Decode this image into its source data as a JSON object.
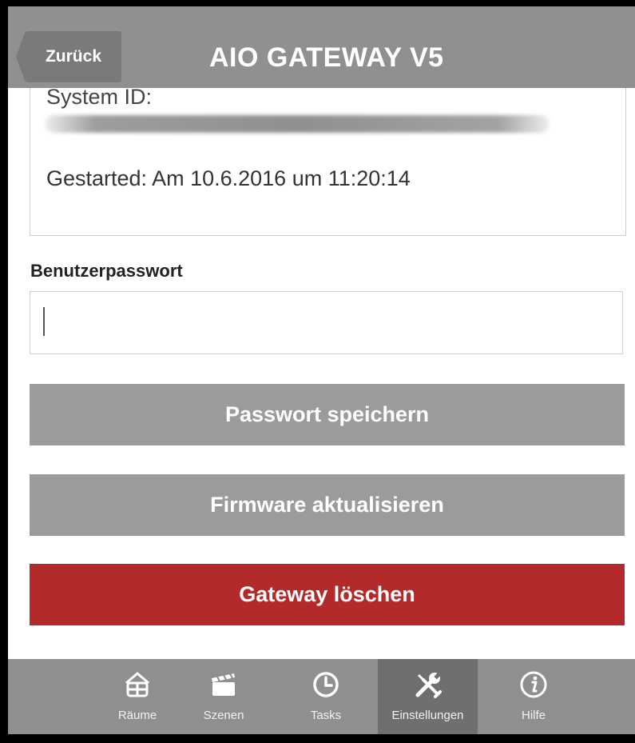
{
  "header": {
    "back_label": "Zurück",
    "title": "AIO GATEWAY V5"
  },
  "info": {
    "system_id_label": "System ID:",
    "started_text": "Gestarted: Am 10.6.2016 um 11:20:14"
  },
  "password": {
    "label": "Benutzerpasswort",
    "value": "",
    "placeholder": ""
  },
  "buttons": {
    "save": "Passwort speichern",
    "firmware": "Firmware aktualisieren",
    "delete": "Gateway löschen"
  },
  "nav": {
    "items": [
      {
        "label": "Räume",
        "icon": "house-icon"
      },
      {
        "label": "Szenen",
        "icon": "clapperboard-icon"
      },
      {
        "label": "Tasks",
        "icon": "clock-icon"
      },
      {
        "label": "Einstellungen",
        "icon": "tools-icon",
        "active": true
      },
      {
        "label": "Hilfe",
        "icon": "info-icon"
      }
    ]
  },
  "colors": {
    "header_bg": "#909090",
    "button_gray": "#9b9b9b",
    "button_red": "#b32a2a",
    "nav_bg": "#8f8f8f",
    "nav_active": "#6f6f6f"
  }
}
